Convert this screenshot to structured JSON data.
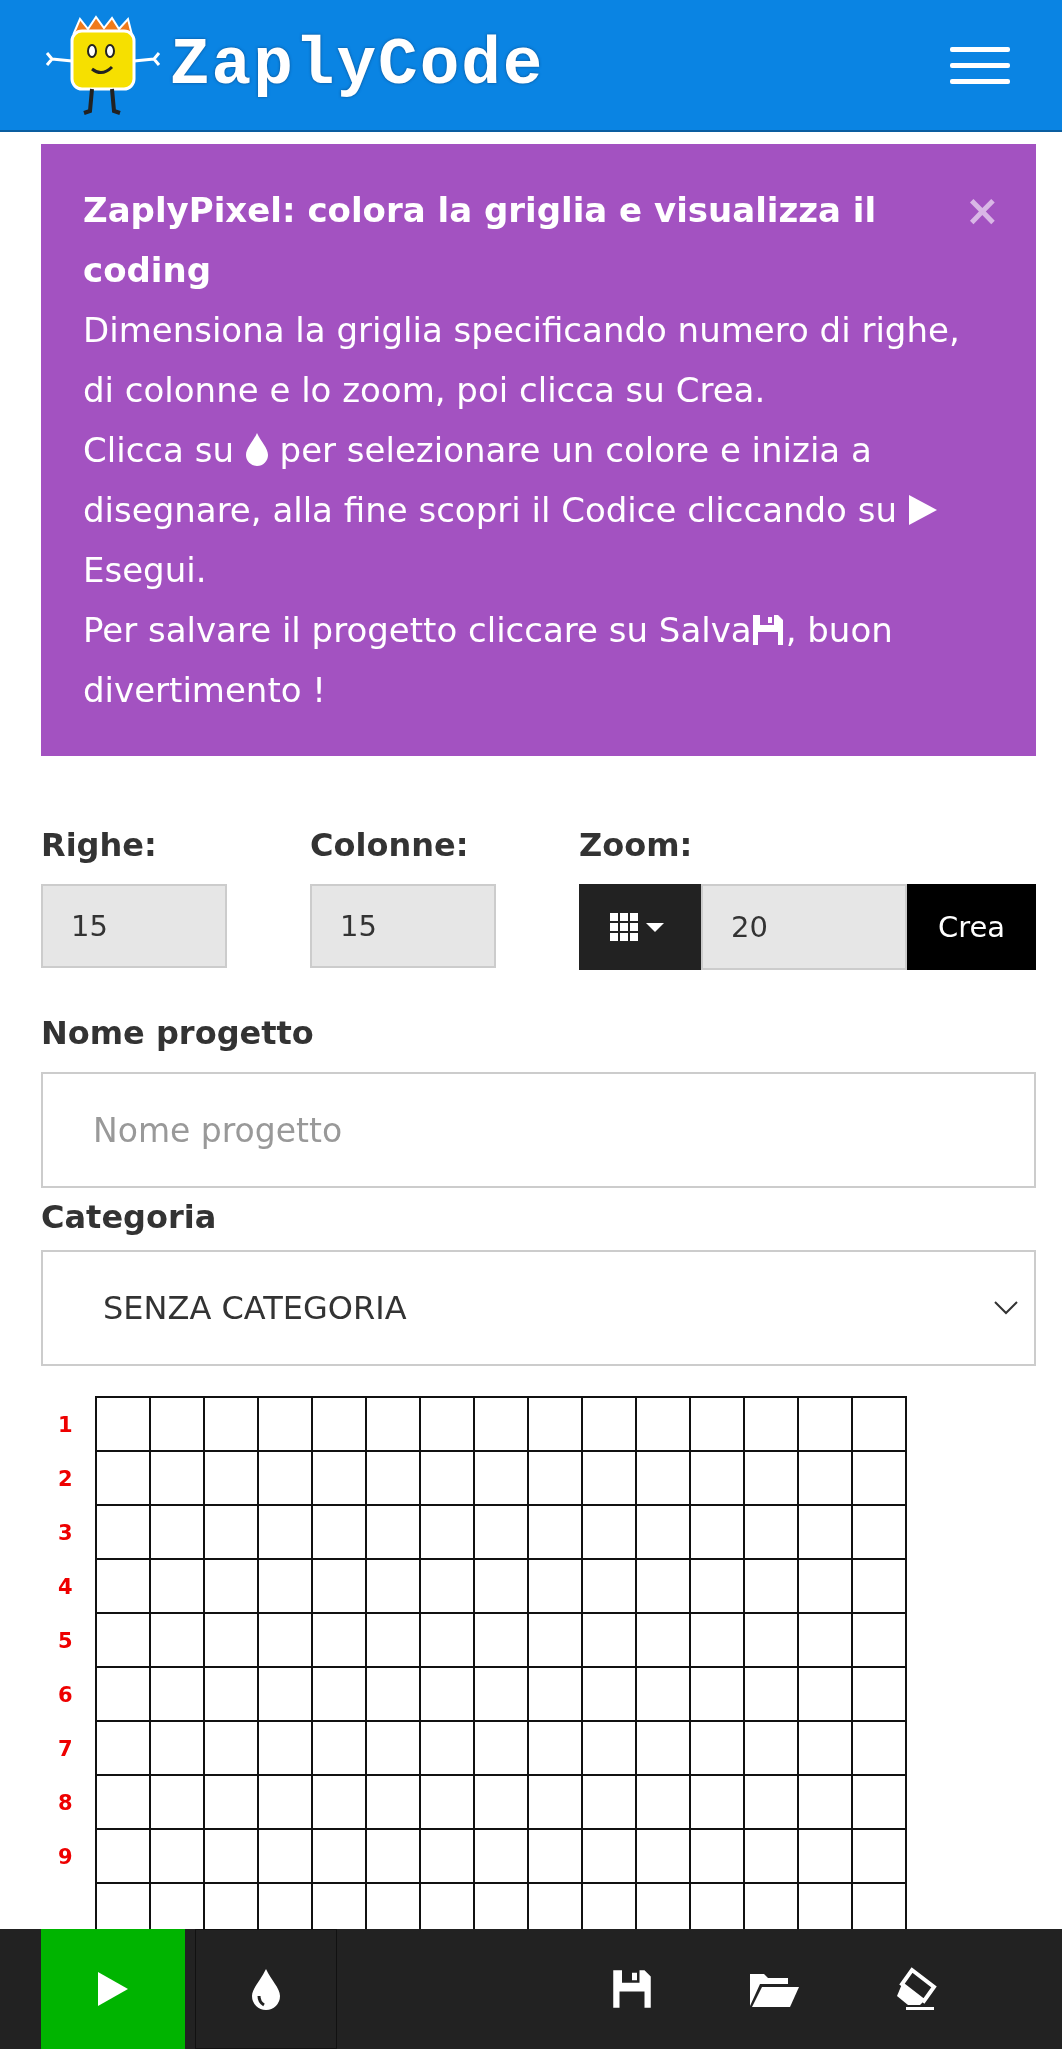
{
  "header": {
    "logo_text": "ZaplyCode"
  },
  "notice": {
    "title": "ZaplyPixel: colora la griglia e visualizza il coding",
    "close": "×",
    "paragraphs": [
      [
        {
          "kind": "text",
          "text": "Dimensiona la griglia specificando numero di righe, di colonne e lo zoom, poi clicca su Crea."
        }
      ],
      [
        {
          "kind": "text",
          "text": "Clicca su"
        },
        {
          "kind": "drop"
        },
        {
          "kind": "text",
          "text": "per selezionare un colore e inizia a"
        },
        {
          "kind": "text",
          "text": "disegnare, alla fine scopri il Codice cliccando su"
        },
        {
          "kind": "play"
        },
        {
          "kind": "text",
          "text": "Esegui."
        }
      ],
      [
        {
          "kind": "text",
          "text": "Per salvare il progetto cliccare su Salva"
        },
        {
          "kind": "floppy"
        },
        {
          "kind": "text",
          "text": ", buon"
        },
        {
          "kind": "text",
          "text": "divertimento !"
        }
      ]
    ]
  },
  "fields": [
    {
      "label": "Righe:",
      "value": "15"
    },
    {
      "label": "Colonne:",
      "value": "15"
    }
  ],
  "zoom": {
    "label": "Zoom:",
    "value": "20",
    "button": "Crea"
  },
  "project_name": {
    "label": "Nome progetto",
    "placeholder": "Nome progetto"
  },
  "category": {
    "label": "Categoria",
    "value": "SENZA CATEGORIA"
  },
  "grid": {
    "row_labels": [
      "1",
      "2",
      "3",
      "4",
      "5",
      "6",
      "7",
      "8",
      "9"
    ]
  },
  "toolbar": [
    {
      "kind": "run"
    },
    {
      "kind": "color"
    },
    {
      "kind": "save"
    },
    {
      "kind": "open"
    },
    {
      "kind": "erase"
    }
  ]
}
